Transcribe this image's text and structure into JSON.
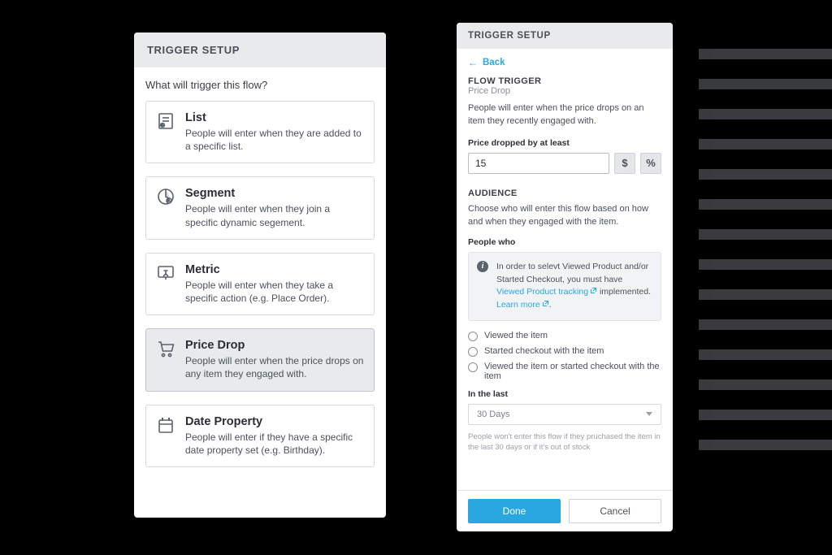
{
  "left": {
    "header": "TRIGGER SETUP",
    "prompt": "What will trigger this flow?",
    "options": [
      {
        "icon": "list-icon",
        "title": "List",
        "desc": "People will enter when they are added to a specific list."
      },
      {
        "icon": "segment-icon",
        "title": "Segment",
        "desc": "People will enter when they join a specific dynamic segement."
      },
      {
        "icon": "metric-icon",
        "title": "Metric",
        "desc": "People will enter when they take a specific action (e.g. Place Order)."
      },
      {
        "icon": "price-drop-icon",
        "title": "Price Drop",
        "desc": "People will enter when the price drops on any item they engaged with.",
        "selected": true
      },
      {
        "icon": "date-prop-icon",
        "title": "Date Property",
        "desc": "People will enter if they have a specific date property set (e.g. Birthday)."
      }
    ]
  },
  "right": {
    "header": "TRIGGER SETUP",
    "back_label": "Back",
    "flow_trigger_heading": "FLOW TRIGGER",
    "flow_trigger_name": "Price Drop",
    "flow_trigger_desc": "People will enter when the price drops on an item they recently engaged with.",
    "price_field_label": "Price dropped by at least",
    "price_value": "15",
    "unit_dollar": "$",
    "unit_percent": "%",
    "audience_heading": "AUDIENCE",
    "audience_desc": "Choose who will enter this flow based on how and when they engaged with the item.",
    "people_who_label": "People who",
    "notice_prefix": "In order to selevt Viewed Product and/or Started Checkout, you must have ",
    "notice_link1": "Viewed Product tracking",
    "notice_mid": " implemented. ",
    "notice_link2": "Learn more",
    "notice_tail": ".",
    "radio_options": [
      "Viewed the item",
      "Started checkout with the item",
      "Viewed the item or started checkout with the item"
    ],
    "in_the_last_label": "In the last",
    "in_the_last_value": "30 Days",
    "fineprint": "People won't enter this flow if they pruchased the item in the last 30 days or if it's out of stock",
    "done_label": "Done",
    "cancel_label": "Cancel"
  }
}
